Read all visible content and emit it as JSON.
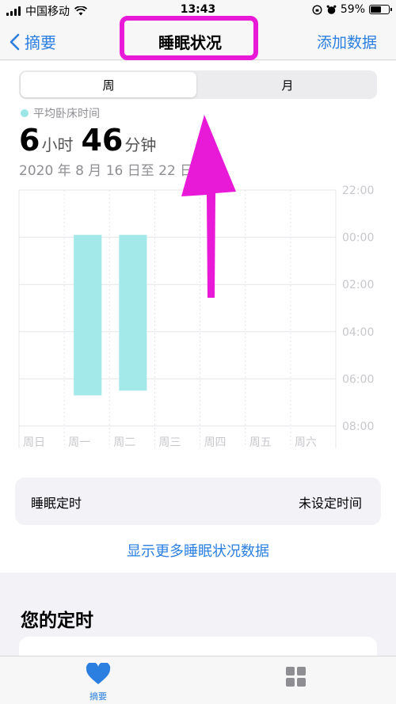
{
  "status_bar": {
    "carrier": "中国移动",
    "time": "13:43",
    "battery": "59%",
    "battery_level": 0.59
  },
  "nav": {
    "back_label": "摘要",
    "title": "睡眠状况",
    "action_label": "添加数据"
  },
  "segmented": {
    "week_label": "周",
    "month_label": "月",
    "selected": "周"
  },
  "summary": {
    "legend_label": "平均卧床时间",
    "hours": "6",
    "hours_unit": "小时",
    "minutes": "46",
    "minutes_unit": "分钟",
    "date_range": "2020 年 8 月 16 日至 22 日"
  },
  "chart_data": {
    "type": "bar",
    "categories": [
      "周日",
      "周一",
      "周二",
      "周三",
      "周四",
      "周五",
      "周六"
    ],
    "y_ticks": [
      "22:00",
      "00:00",
      "02:00",
      "04:00",
      "06:00",
      "08:00"
    ],
    "ylim": [
      0,
      10
    ],
    "bar_color": "#a3e9e9",
    "series": [
      {
        "ranges": [
          null,
          [
            1.9,
            8.7
          ],
          [
            1.9,
            8.5
          ],
          null,
          null,
          null,
          null
        ]
      }
    ]
  },
  "schedule": {
    "label": "睡眠定时",
    "value": "未设定时间"
  },
  "more_link": "显示更多睡眠状况数据",
  "section_title": "您的定时",
  "tab_bar": {
    "summary_label": "摘要"
  },
  "colors": {
    "accent": "#2b7fe0",
    "highlight": "#e81ad8",
    "bar": "#a3e9e9"
  }
}
